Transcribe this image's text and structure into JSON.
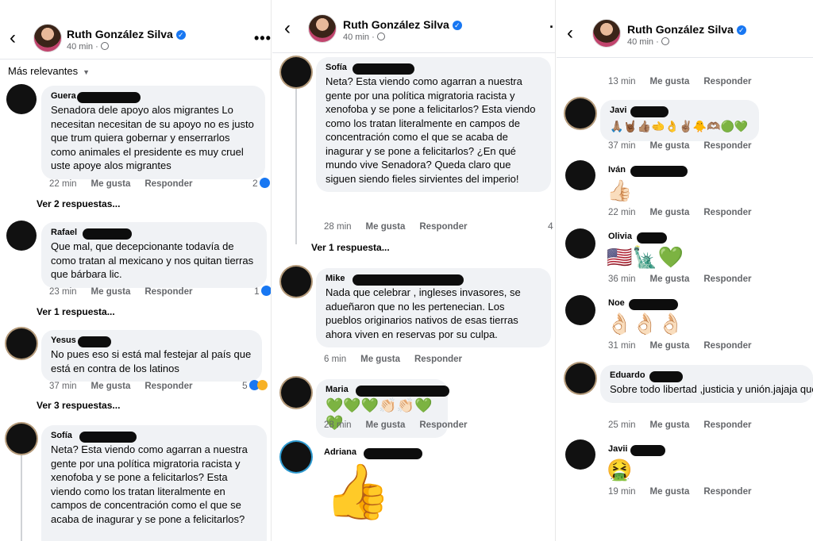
{
  "header": {
    "name": "Ruth González Silva",
    "time": "40 min",
    "verified_icon": "verified-badge-icon",
    "more_label": "•••"
  },
  "sort_label": "Más relevantes",
  "actions": {
    "like": "Me gusta",
    "reply": "Responder"
  },
  "panel1": {
    "comments": [
      {
        "author": "Guera",
        "text": "Senadora dele apoyo alos migrantes Lo necesitan necesitan de su apoyo no es justo que trum quiera gobernar y enserrarlos como animales el presidente es muy cruel uste apoye alos migrantes",
        "time": "22 min",
        "reactions": "2",
        "replies": "Ver 2 respuestas..."
      },
      {
        "author": "Rafael",
        "text": "Que mal, que decepcionante todavía de como tratan al mexicano y nos quitan tierras que bárbara lic.",
        "time": "23 min",
        "reactions": "1",
        "replies": "Ver 1 respuesta..."
      },
      {
        "author": "Yesus",
        "text": "No pues eso si está mal festejar al país que está en contra de los latinos",
        "time": "37 min",
        "reactions": "5",
        "replies": "Ver 3 respuestas..."
      },
      {
        "author": "Sofía",
        "text": "Neta? Esta viendo como agarran a nuestra gente por una política migratoria racista y xenofoba y se pone a felicitarlos? Esta viendo como los tratan literalmente en campos de concentración como el que se acaba de inagurar y se pone a felicitarlos?"
      }
    ]
  },
  "panel2": {
    "comments": [
      {
        "author": "Sofía",
        "text": "Neta? Esta viendo como agarran a nuestra gente por una política migratoria racista y xenofoba y se pone a felicitarlos? Esta viendo como los tratan literalmente en campos de concentración como el que se acaba de inagurar y se pone a felicitarlos? ¿En qué mundo vive Senadora? Queda claro que siguen siendo fieles sirvientes del imperio!",
        "time": "28 min",
        "reactions": "4",
        "replies": "Ver 1 respuesta..."
      },
      {
        "author": "Mike",
        "text": "Nada que celebrar , ingleses invasores, se adueñaron que no les pertenecian. Los pueblos originarios nativos de esas tierras ahora viven en reservas por su culpa.",
        "time": "6 min"
      },
      {
        "author": "Maria",
        "text": "💚💚💚👏🏻👏🏻💚💚",
        "time": "28 min"
      },
      {
        "author": "Adriana",
        "text": "👍"
      }
    ]
  },
  "panel3": {
    "top_time": "13 min",
    "comments": [
      {
        "author": "Javi",
        "text": "🙏🏽🤘🏾👍🏽🫲👌✌🏽🐥🫶🏽🟢💚",
        "time": "37 min"
      },
      {
        "author": "Iván",
        "text": "👍🏻",
        "time": "22 min"
      },
      {
        "author": "Olivia",
        "text": "🇺🇸🗽💚",
        "time": "36 min"
      },
      {
        "author": "Noe",
        "text": "👌🏻👌🏻👌🏻",
        "time": "31 min"
      },
      {
        "author": "Eduardo",
        "text": "Sobre todo libertad ,justicia y unión.jajaja que buen chiste senadora.",
        "time": "25 min"
      },
      {
        "author": "Javii",
        "text": "🤮",
        "time": "19 min"
      }
    ]
  },
  "colors": {
    "accent": "#1877f2",
    "bubble": "#f0f2f5",
    "meta": "#65676b"
  }
}
